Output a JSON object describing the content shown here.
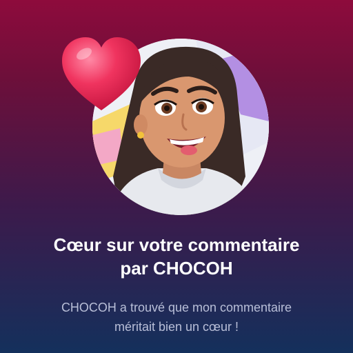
{
  "notification": {
    "title_line1": "Cœur sur votre commentaire",
    "title_line2": "par CHOCOH",
    "message_line1": "CHOCOH a trouvé que mon commentaire",
    "message_line2": "méritait bien un cœur !"
  },
  "icons": {
    "badge": "heart-icon",
    "avatar": "user-avatar"
  },
  "colors": {
    "background_top": "#8e0b3c",
    "background_bottom": "#14305c",
    "heart": "#e8244f",
    "title_text": "#ffffff",
    "message_text": "#b9bfd8"
  }
}
